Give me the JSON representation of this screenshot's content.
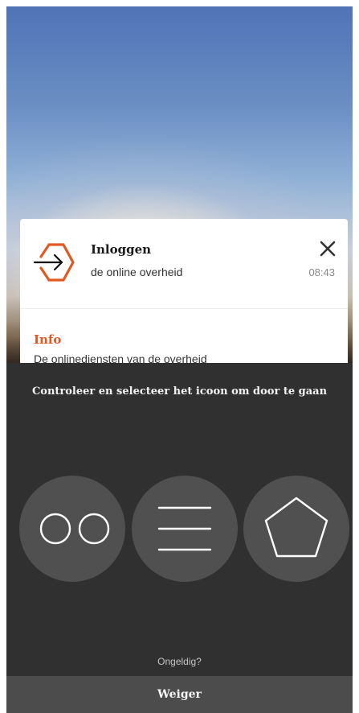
{
  "notification": {
    "title": "Inloggen",
    "subtitle": "de online overheid",
    "time": "08:43",
    "info_heading": "Info",
    "info_text": "De onlinediensten van de overheid",
    "logo_icon": "login-arrow-hexagon-icon",
    "close_icon": "close-icon"
  },
  "challenge": {
    "instruction": "Controleer en selecteer het icoon om door te gaan",
    "choices": [
      {
        "icon": "two-circles-icon"
      },
      {
        "icon": "three-lines-icon"
      },
      {
        "icon": "pentagon-icon"
      }
    ],
    "invalid_label": "Ongeldig?",
    "reject_label": "Weiger"
  },
  "colors": {
    "accent": "#e25822",
    "overlay": "#303030",
    "choice_bg": "#505050",
    "reject_bar": "#4c4c4c"
  }
}
